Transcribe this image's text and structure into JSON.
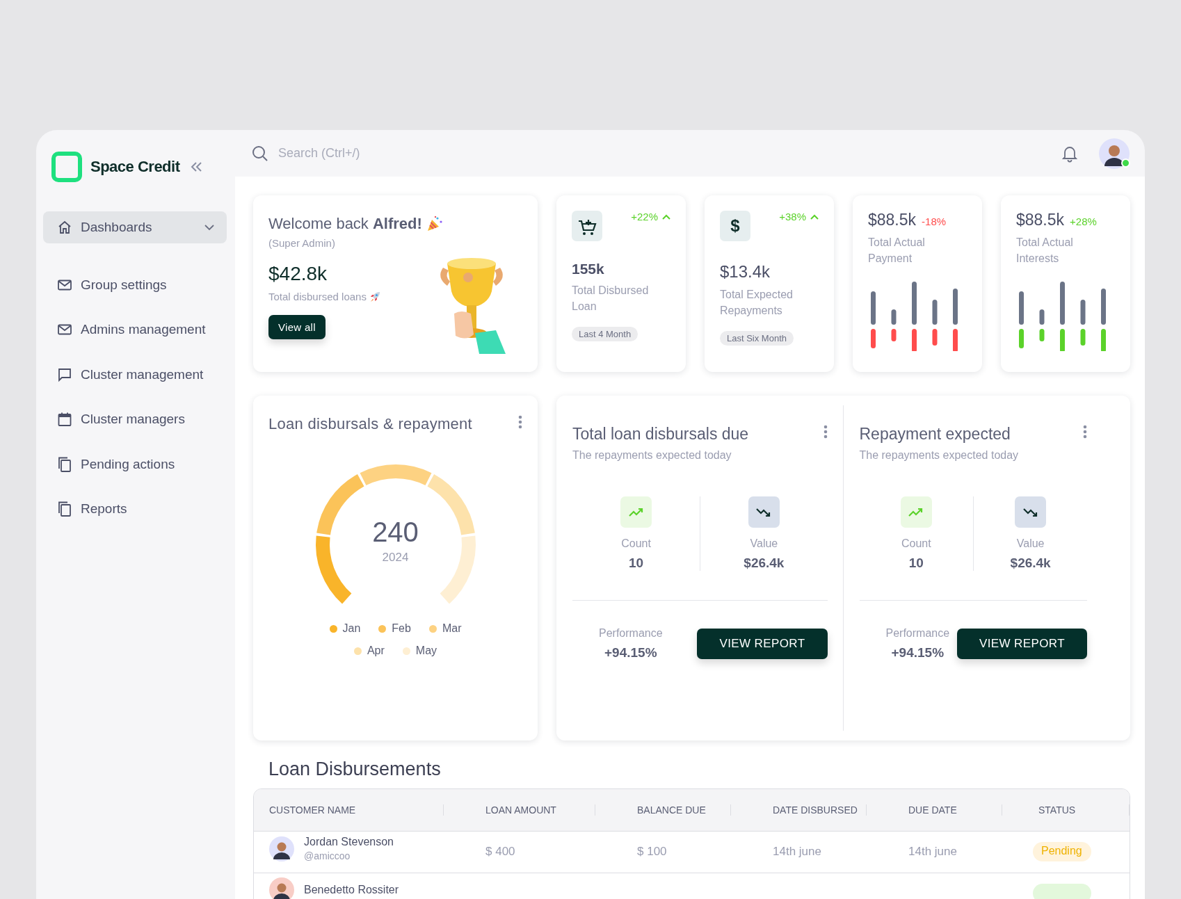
{
  "sidebar": {
    "brand": "Space Credit",
    "items": [
      {
        "label": "Dashboards",
        "kind": "home",
        "selected": true,
        "expandable": true
      },
      {
        "label": "Group settings",
        "kind": "mail",
        "selected": false,
        "expandable": false
      },
      {
        "label": "Admins management",
        "kind": "mail",
        "selected": false,
        "expandable": false
      },
      {
        "label": "Cluster management",
        "kind": "chat",
        "selected": false,
        "expandable": false
      },
      {
        "label": "Cluster managers",
        "kind": "calendar",
        "selected": false,
        "expandable": false
      },
      {
        "label": "Pending actions",
        "kind": "copy",
        "selected": false,
        "expandable": false
      },
      {
        "label": "Reports",
        "kind": "copy",
        "selected": false,
        "expandable": false
      }
    ]
  },
  "search": {
    "placeholder": "Search (Ctrl+/)"
  },
  "user": {
    "online": true
  },
  "welcome": {
    "greeting": "Welcome back **Alfred!**",
    "role": "(Super Admin)",
    "amount": "$42.8k",
    "caption": "Total disbursed loans",
    "button": "View all"
  },
  "stat_cards": [
    {
      "kind": "cart",
      "change": "+22%",
      "color": "#5bd22a",
      "value": "155k",
      "label": "Total Disbursed Loan",
      "tag": "Last 4 Month"
    },
    {
      "kind": "symbol",
      "symbol": "$",
      "change": "+38%",
      "color": "#5bd22a",
      "value": "$13.4k",
      "label": "Total Expected Repayments",
      "tag": "Last Six Month"
    },
    {
      "kind": "bars",
      "change": "-18%",
      "color": "#ff4c4c",
      "value": "$88.5k",
      "label": "Total Actual Payment"
    },
    {
      "kind": "bars",
      "change": "+28%",
      "color": "#5bd22a",
      "value": "$88.5k",
      "label": "Total Actual Interests"
    }
  ],
  "gauge_card": {
    "title": "Loan disbursals & repayment",
    "total": "240",
    "year": "2024",
    "legend": [
      {
        "label": "Jan",
        "color": "#f9b42a"
      },
      {
        "label": "Feb",
        "color": "#fbc359"
      },
      {
        "label": "Mar",
        "color": "#fdd282"
      },
      {
        "label": "Apr",
        "color": "#fde2ab"
      },
      {
        "label": "May",
        "color": "#feefd3"
      }
    ]
  },
  "due_panels": [
    {
      "title": "Total loan disbursals due",
      "subtitle": "The repayments expected today",
      "metrics": [
        {
          "kind": "up",
          "label": "Count",
          "value": "10"
        },
        {
          "kind": "down",
          "label": "Value",
          "value": "$26.4k"
        }
      ],
      "performance_label": "Performance",
      "performance": "+94.15%",
      "button": "VIEW REPORT"
    },
    {
      "title": "Repayment expected",
      "subtitle": "The repayments expected today",
      "metrics": [
        {
          "kind": "up",
          "label": "Count",
          "value": "10"
        },
        {
          "kind": "down",
          "label": "Value",
          "value": "$26.4k"
        }
      ],
      "performance_label": "Performance",
      "performance": "+94.15%",
      "button": "VIEW REPORT"
    }
  ],
  "table": {
    "title": "Loan Disbursements",
    "columns": [
      "CUSTOMER NAME",
      "LOAN AMOUNT",
      "BALANCE DUE",
      "DATE DISBURSED",
      "DUE DATE",
      "STATUS"
    ],
    "rows": [
      {
        "name": "Jordan Stevenson",
        "handle": "@amiccoo",
        "loan_amount": "$ 400",
        "balance_due": "$ 100",
        "date_disbursed": "14th june",
        "due_date": "14th june",
        "status": "Pending",
        "color": "#fff3dc"
      },
      {
        "name": "Benedetto Rossiter",
        "color": "#e3f8dc"
      }
    ]
  }
}
